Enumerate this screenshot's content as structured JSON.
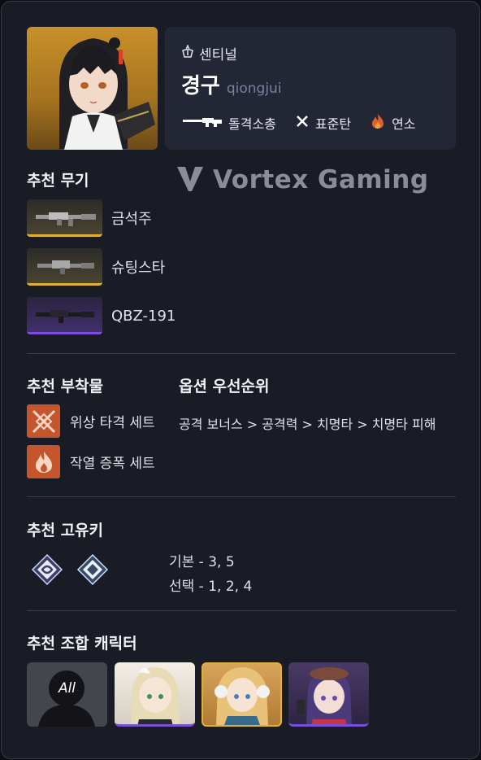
{
  "character": {
    "class_label": "센티널",
    "name_ko": "경구",
    "name_en": "qiongjui",
    "tags": [
      {
        "icon": "rifle-icon",
        "label": "돌격소총"
      },
      {
        "icon": "standard-ammo-icon",
        "label": "표준탄"
      },
      {
        "icon": "fire-icon",
        "label": "연소",
        "color": "#e0602a"
      }
    ]
  },
  "watermark": {
    "text": "Vortex Gaming"
  },
  "weapons": {
    "title": "추천 무기",
    "items": [
      {
        "label": "금석주",
        "rarity_color": "#e0b132"
      },
      {
        "label": "슈팅스타",
        "rarity_color": "#e0b132"
      },
      {
        "label": "QBZ-191",
        "rarity_color": "#7d4ee0"
      }
    ]
  },
  "attachments": {
    "title": "추천 부착물",
    "items": [
      {
        "icon": "phase-strike-icon",
        "label": "위상 타격 세트"
      },
      {
        "icon": "flame-burst-icon",
        "label": "작열 증폭 세트"
      }
    ]
  },
  "options": {
    "title": "옵션 우선순위",
    "text": "공격 보너스 > 공격력 > 치명타 > 치명타 피해"
  },
  "keys": {
    "title": "추천 고유키",
    "basic": "기본 - 3, 5",
    "select": "선택 - 1, 2, 4"
  },
  "team": {
    "title": "추천 조합 캐릭터",
    "all_label": "All"
  },
  "colors": {
    "background": "#1a1c25",
    "panel": "#232634",
    "gold": "#e0b132",
    "purple": "#7d4ee0",
    "orange": "#c4552c"
  }
}
